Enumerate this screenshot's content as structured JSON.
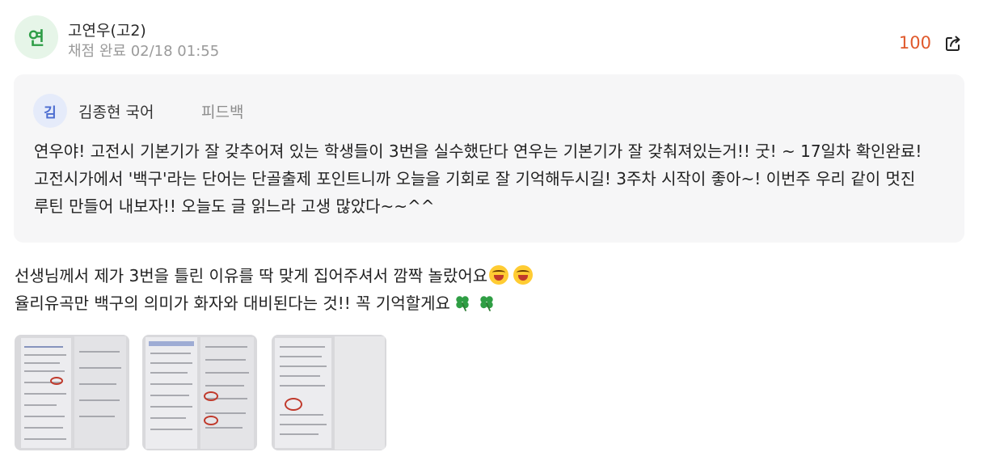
{
  "post": {
    "avatar_char": "연",
    "author": "고연우(고2)",
    "status": "채점 완료",
    "datetime": "02/18 01:55",
    "score": "100",
    "share_icon": "share-icon"
  },
  "feedback": {
    "avatar_char": "김",
    "teacher": "김종현 국어",
    "tag": "피드백",
    "body": "연우야! 고전시 기본기가 잘 갖추어져 있는 학생들이 3번을 실수했단다 연우는 기본기가 잘 갖춰져있는거!! 굿! ~ 17일차 확인완료! 고전시가에서 '백구'라는 단어는 단골출제 포인트니까 오늘을 기회로 잘 기억해두시길! 3주차 시작이 좋아~! 이번주 우리 같이 멋진 루틴 만들어 내보자!! 오늘도 글 읽느라 고생 많았다~~^^"
  },
  "comment": {
    "line1": "선생님께서 제가 3번을 틀린 이유를 딱 맞게 집어주셔서 깜짝 놀랐어요",
    "line2": "율리유곡만 백구의 의미가 화자와 대비된다는 것!! 꼭 기억할게요",
    "emoji_line1": "laughing-face-icon",
    "emoji_line2": "four-leaf-clover-icon"
  },
  "attachments": [
    {
      "name": "attachment-photo-1"
    },
    {
      "name": "attachment-photo-2"
    },
    {
      "name": "attachment-photo-3"
    }
  ],
  "colors": {
    "score": "#e0592b",
    "avatar_bg": "#e6f5e8",
    "avatar_fg": "#2e9d46",
    "feedback_bg": "#f6f6f7",
    "teacher_avatar_bg": "#e5ebfa"
  }
}
